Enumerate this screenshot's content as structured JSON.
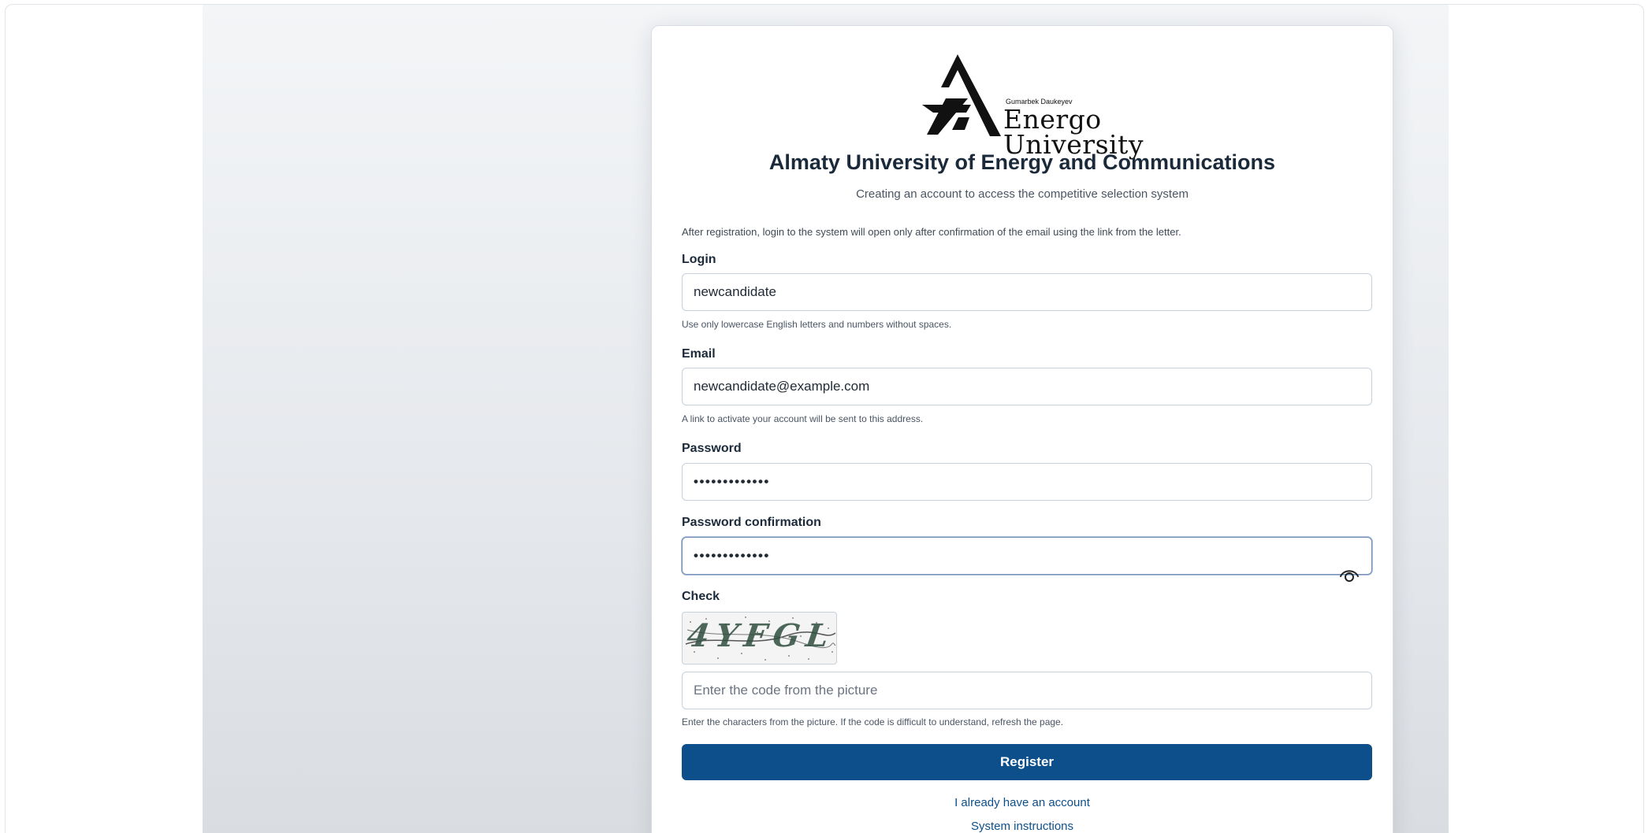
{
  "logo": {
    "small_text": "Gumarbek Daukeyev",
    "line1": "Energo",
    "line2": "University"
  },
  "header": {
    "title": "Almaty University of Energy and Communications",
    "subtitle": "Creating an account to access the competitive selection system"
  },
  "notice": "After registration, login to the system will open only after confirmation of the email using the link from the letter.",
  "form": {
    "login": {
      "label": "Login",
      "value": "newcandidate",
      "hint": "Use only lowercase English letters and numbers without spaces."
    },
    "email": {
      "label": "Email",
      "value": "newcandidate@example.com",
      "hint": "A link to activate your account will be sent to this address."
    },
    "password": {
      "label": "Password",
      "value": "•••••••••••••"
    },
    "password_confirmation": {
      "label": "Password confirmation",
      "value": "•••••••••••••",
      "toggle_icon": "eye-icon"
    },
    "check": {
      "label": "Check",
      "captcha_text": "4YFGL",
      "placeholder": "Enter the code from the picture",
      "hint": "Enter the characters from the picture. If the code is difficult to understand, refresh the page."
    },
    "submit_label": "Register"
  },
  "links": {
    "have_account": "I already have an account",
    "instructions": "System instructions"
  },
  "colors": {
    "primary": "#0d4f8b",
    "text": "#1b2a3a",
    "border": "#c8d0d9"
  }
}
